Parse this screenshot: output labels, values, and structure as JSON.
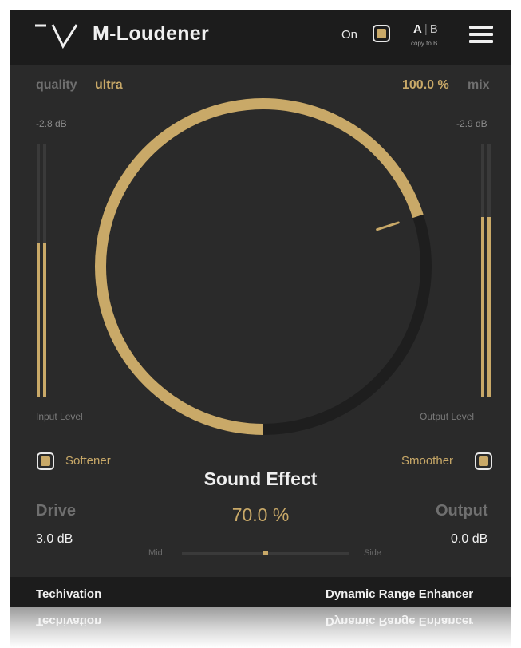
{
  "header": {
    "title": "M-Loudener",
    "power": {
      "label": "On",
      "enabled": true
    },
    "ab": {
      "a": "A",
      "b": "B",
      "copy_label": "copy to B"
    }
  },
  "quality": {
    "label": "quality",
    "value": "ultra"
  },
  "mix": {
    "value": "100.0 %",
    "label": "mix"
  },
  "input_meter": {
    "db": "-2.8 dB",
    "label": "Input Level",
    "level_left": 0.61,
    "level_right": 0.61
  },
  "output_meter": {
    "db": "-2.9 dB",
    "label": "Output Level",
    "level_left": 0.71,
    "level_right": 0.71
  },
  "sound_effect": {
    "title": "Sound Effect",
    "value": "70.0 %",
    "fraction": 0.7
  },
  "softener": {
    "label": "Softener",
    "checked": true
  },
  "smoother": {
    "label": "Smoother",
    "checked": true
  },
  "drive": {
    "label": "Drive",
    "value": "3.0 dB"
  },
  "output": {
    "label": "Output",
    "value": "0.0 dB"
  },
  "mid_side": {
    "mid_label": "Mid",
    "side_label": "Side",
    "position": 0.5
  },
  "footer": {
    "brand": "Techivation",
    "product": "Dynamic Range Enhancer"
  },
  "colors": {
    "accent": "#c9a968",
    "panel": "#2a2a2a",
    "header": "#1c1c1c"
  },
  "icons": {
    "logo": "techivation-logo-icon",
    "menu": "hamburger-menu-icon"
  }
}
